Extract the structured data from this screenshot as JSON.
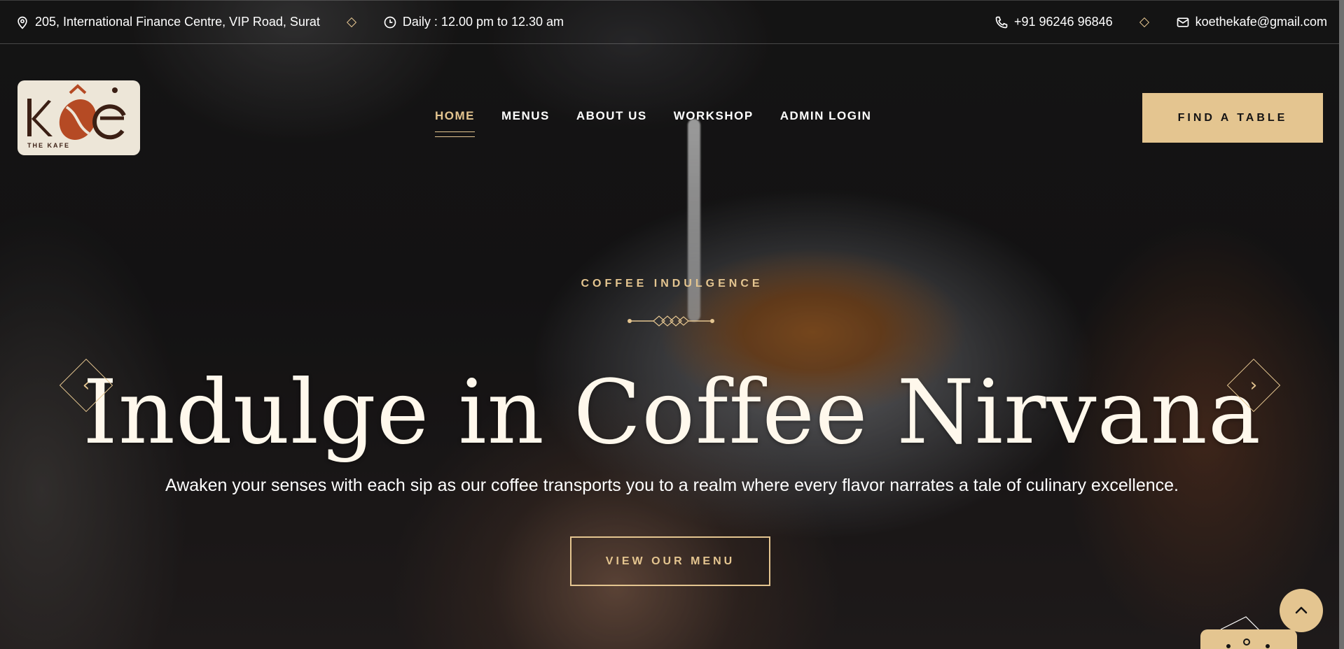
{
  "topbar": {
    "address": "205, International Finance Centre, VIP Road, Surat",
    "hours": "Daily : 12.00 pm to 12.30 am",
    "phone": "+91 96246 96846",
    "email": "koethekafe@gmail.com",
    "icons": [
      "location-pin-icon",
      "clock-icon",
      "phone-icon",
      "mail-icon"
    ]
  },
  "logo": {
    "mark": "KÔĖ",
    "subtitle": "THE KAFE"
  },
  "nav": {
    "items": [
      "HOME",
      "MENUS",
      "ABOUT US",
      "WORKSHOP",
      "ADMIN LOGIN"
    ],
    "active": "HOME"
  },
  "header": {
    "cta_label": "FIND A TABLE"
  },
  "hero": {
    "eyebrow": "COFFEE INDULGENCE",
    "title": "Indulge in Coffee Nirvana",
    "text": "Awaken your senses with each sip as our coffee transports you to a realm where every flavor narrates a tale of culinary excellence.",
    "button_label": "VIEW OUR MENU"
  },
  "controls": {
    "prev_icon": "chevron-left-icon",
    "next_icon": "chevron-right-icon",
    "scroll_top_icon": "chevron-up-icon"
  },
  "colors": {
    "accent": "#e4c590",
    "background": "#151414",
    "logo_bg": "#ede6d8",
    "logo_brown": "#3b1f14",
    "bean": "#b54a24"
  }
}
